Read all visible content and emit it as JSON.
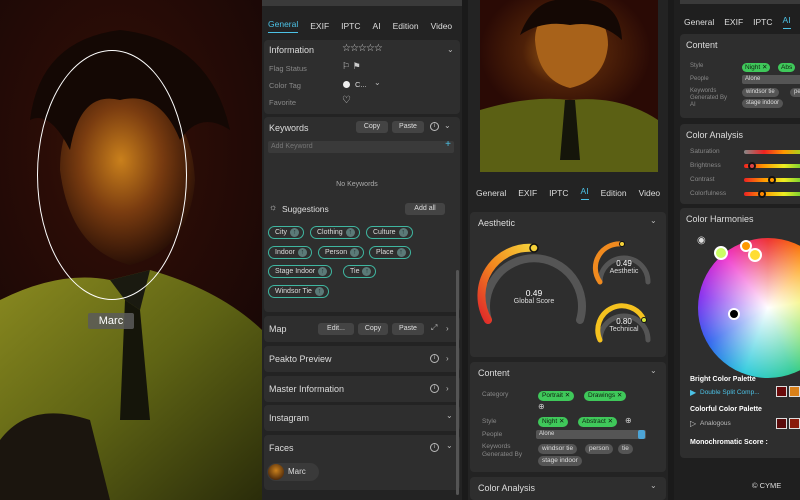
{
  "face_label": "Marc",
  "panel_left": {
    "tabs": [
      "General",
      "EXIF",
      "IPTC",
      "AI",
      "Edition",
      "Video"
    ],
    "active_tab": "General",
    "information": {
      "title": "Information",
      "flag_status": "Flag Status",
      "color_tag": "Color Tag",
      "color_tag_value": "C...",
      "favorite": "Favorite"
    },
    "keywords": {
      "title": "Keywords",
      "copy": "Copy",
      "paste": "Paste",
      "placeholder": "Add Keyword",
      "empty": "No Keywords"
    },
    "suggestions": {
      "title": "Suggestions",
      "add_all": "Add all",
      "chips": [
        "City",
        "Clothing",
        "Culture",
        "Indoor",
        "Person",
        "Place",
        "Stage Indoor",
        "Tie",
        "Windsor Tie"
      ]
    },
    "map": {
      "title": "Map",
      "edit": "Edit...",
      "copy": "Copy",
      "paste": "Paste"
    },
    "peakto_preview": "Peakto Preview",
    "master_information": "Master Information",
    "instagram": "Instagram",
    "faces": {
      "title": "Faces",
      "person": "Marc"
    }
  },
  "panel_mid": {
    "tabs": [
      "General",
      "EXIF",
      "IPTC",
      "AI",
      "Edition",
      "Video"
    ],
    "active_tab": "AI",
    "aesthetic": {
      "title": "Aesthetic",
      "global_score": "0.49",
      "global_label": "Global Score",
      "aesthetic_score": "0.49",
      "aesthetic_label": "Aesthetic",
      "technical_score": "0.80",
      "technical_label": "Technical"
    },
    "content": {
      "title": "Content",
      "category_label": "Category",
      "categories": [
        "Portrait",
        "Drawings"
      ],
      "style_label": "Style",
      "styles": [
        "Night",
        "Abstract"
      ],
      "people_label": "People",
      "people_value": "Alone",
      "keywords_label": "Keywords",
      "keywords_label2": "Generated By",
      "keywords": [
        "windsor tie",
        "person",
        "tie",
        "stage indoor"
      ]
    },
    "color_analysis": "Color Analysis"
  },
  "panel_right": {
    "tabs": [
      "General",
      "EXIF",
      "IPTC",
      "AI"
    ],
    "active_tab": "AI",
    "content": {
      "title": "Content",
      "style_label": "Style",
      "styles": [
        "Night",
        "Abs"
      ],
      "people_label": "People",
      "people_value": "Alone",
      "keywords_label": "Keywords",
      "keywords_label2": "Generated By",
      "keywords_label3": "AI",
      "keywords": [
        "windsor tie",
        "per",
        "stage indoor"
      ]
    },
    "color_analysis": {
      "title": "Color Analysis",
      "saturation": "Saturation",
      "brightness": "Brightness",
      "contrast": "Contrast",
      "colorfulness": "Colorfulness"
    },
    "color_harmonies": {
      "title": "Color Harmonies",
      "bright_palette": "Bright Color Palette",
      "bright_value": "Double Split Comp...",
      "colorful_palette": "Colorful Color Palette",
      "colorful_value": "Analogous",
      "mono": "Monochromatic Score :"
    },
    "copyright": "© CYME"
  }
}
